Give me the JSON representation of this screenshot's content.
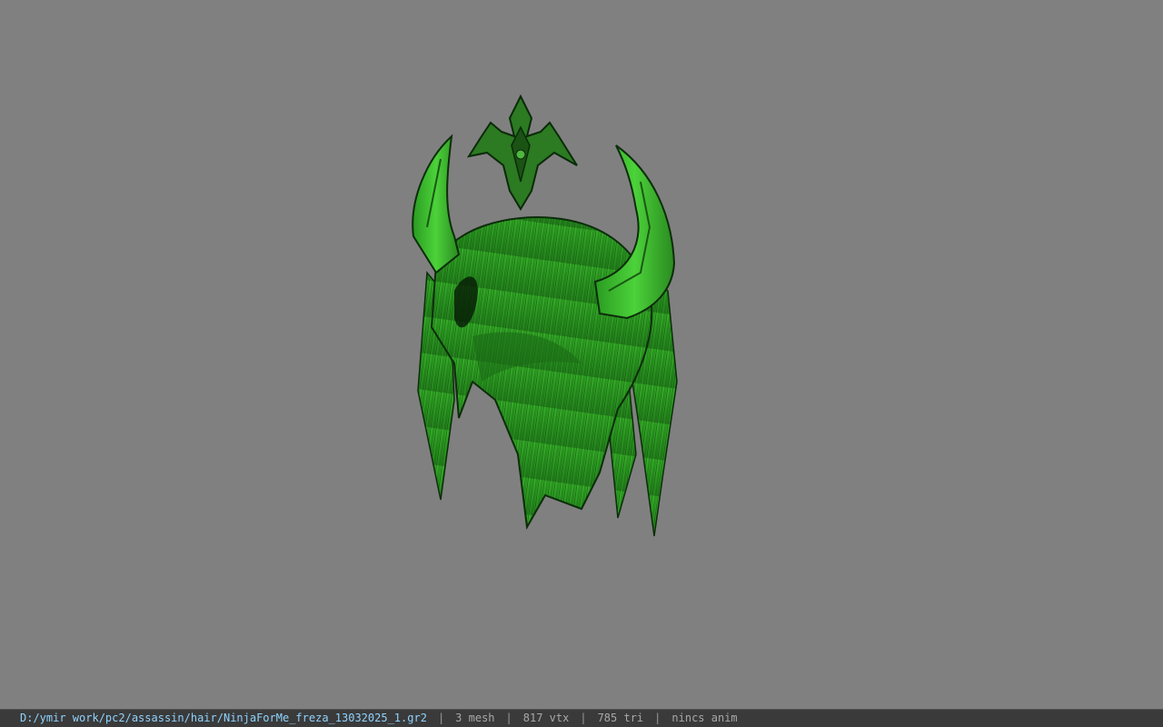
{
  "viewport": {
    "background_color": "#808080",
    "model_color": "#2ea82a",
    "model": "green horned hair mesh with crest ornament"
  },
  "status_bar": {
    "file_path": "D:/ymir work/pc2/assassin/hair/NinjaForMe_freza_13032025_1.gr2",
    "separator": "|",
    "mesh_count": "3 mesh",
    "vertex_count": "817 vtx",
    "triangle_count": "785 tri",
    "animation": "nincs anim"
  }
}
